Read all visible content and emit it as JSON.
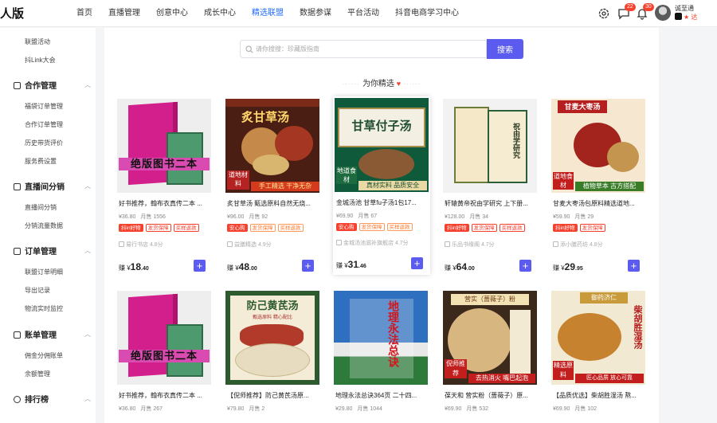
{
  "brand": "人版",
  "nav": [
    "首页",
    "直播管理",
    "创意中心",
    "成长中心",
    "精选联盟",
    "数据参谋",
    "平台活动",
    "抖音电商学习中心"
  ],
  "nav_active": 4,
  "top": {
    "msg_badge": "22",
    "bell_badge": "30",
    "user_name": "诚至通",
    "user_status": "★ 达"
  },
  "sidebar": {
    "top_items": [
      "联盟活动",
      "抖Link大会"
    ],
    "groups": [
      {
        "label": "合作管理",
        "items": [
          "福袋订单管理",
          "合作订单管理",
          "历史带货评价",
          "服务费设置"
        ]
      },
      {
        "label": "直播间分销",
        "items": [
          "直播间分销",
          "分销流量数据"
        ]
      },
      {
        "label": "订单管理",
        "items": [
          "联盟订单明细",
          "导出记录",
          "物流实时监控"
        ]
      },
      {
        "label": "账单管理",
        "items": [
          "佣金分佣账单",
          "余额管理"
        ]
      },
      {
        "label": "排行榜",
        "items": []
      }
    ]
  },
  "search": {
    "placeholder": "请你搜搜：珍藏版指南",
    "button": "搜索"
  },
  "section_title": "为你精选",
  "products": [
    {
      "title": "好书推荐，翰布衣真传二本 ...",
      "price": "¥36.80",
      "sold": "月售 1556",
      "tags": [
        "抖in好物",
        "发货保障",
        "买样返款"
      ],
      "shop": "易行书店 4.8分",
      "buy_prefix": "赚 ¥",
      "buy_int": "18",
      "buy_dec": ".40",
      "img_text": [
        "绝版图书二本"
      ]
    },
    {
      "title": "炙甘草汤 甄选原料自然无烧...",
      "price": "¥96.00",
      "sold": "月售 92",
      "tags": [
        "安心购",
        "发货保障",
        "买样返款"
      ],
      "shop": "益膳精选 4.9分",
      "buy_prefix": "赚 ¥",
      "buy_int": "48",
      "buy_dec": ".00",
      "img_text": [
        "炙甘草汤",
        "道地材料",
        "手工精选 干净无杂"
      ]
    },
    {
      "title": "金城汤池 甘草fu子汤1包17...",
      "price": "¥69.90",
      "sold": "月售 67",
      "tags": [
        "安心购",
        "发货保障",
        "买样返款"
      ],
      "shop": "金城汤池滋补旗舰店 4.7分",
      "buy_prefix": "赚 ¥",
      "buy_int": "31",
      "buy_dec": ".46",
      "img_text": [
        "甘草付子汤",
        "地道食材",
        "真材实料 品质安全"
      ]
    },
    {
      "title": "轩辕黄帝祝由学研究 上下册...",
      "price": "¥128.00",
      "sold": "月售 34",
      "tags": [
        "抖in好物",
        "发货保障",
        "买样返款"
      ],
      "shop": "乐品书缘阁 4.7分",
      "buy_prefix": "赚 ¥",
      "buy_int": "64",
      "buy_dec": ".00",
      "img_text": [
        "祝由学研究"
      ]
    },
    {
      "title": "甘麦大枣汤包原料精选道地...",
      "price": "¥59.90",
      "sold": "月售 29",
      "tags": [
        "抖in好物",
        "发货保障"
      ],
      "shop": "添小膳药坊 4.8分",
      "buy_prefix": "赚 ¥",
      "buy_int": "29",
      "buy_dec": ".95",
      "img_text": [
        "甘麦大枣汤",
        "道地食材",
        "植物草本 古方搭配"
      ]
    },
    {
      "title": "好书推荐，翰布衣真传二本 ...",
      "price": "¥36.80",
      "sold": "月售 267",
      "tags": [],
      "shop": "",
      "buy_prefix": "",
      "buy_int": "",
      "buy_dec": "",
      "img_text": [
        "绝版图书二本"
      ]
    },
    {
      "title": "【倪师推荐】防己黄芪汤原...",
      "price": "¥79.80",
      "sold": "月售 2",
      "tags": [],
      "shop": "",
      "buy_prefix": "",
      "buy_int": "",
      "buy_dec": "",
      "img_text": [
        "防己黄芪汤",
        "甄选原料 精心配比"
      ]
    },
    {
      "title": "地理永法总诀364页 二十四...",
      "price": "¥29.80",
      "sold": "月售 1044",
      "tags": [],
      "shop": "",
      "buy_prefix": "",
      "buy_int": "",
      "buy_dec": "",
      "img_text": [
        "地理",
        "永法",
        "总诀"
      ]
    },
    {
      "title": "葆天和 营实粉（蔷薇子）原...",
      "price": "¥69.90",
      "sold": "月售 532",
      "tags": [],
      "shop": "",
      "buy_prefix": "",
      "buy_int": "",
      "buy_dec": "",
      "img_text": [
        "营实（蔷薇子）粉",
        "倪师推荐",
        "去热消火 嘴巴起泡"
      ]
    },
    {
      "title": "【品质优选】柴胡胜湿汤 熬...",
      "price": "¥69.90",
      "sold": "月售 102",
      "tags": [],
      "shop": "",
      "buy_prefix": "",
      "buy_int": "",
      "buy_dec": "",
      "img_text": [
        "柴胡胜湿汤",
        "御药济仁",
        "精选原料",
        "匠心品质 放心可靠"
      ]
    }
  ]
}
